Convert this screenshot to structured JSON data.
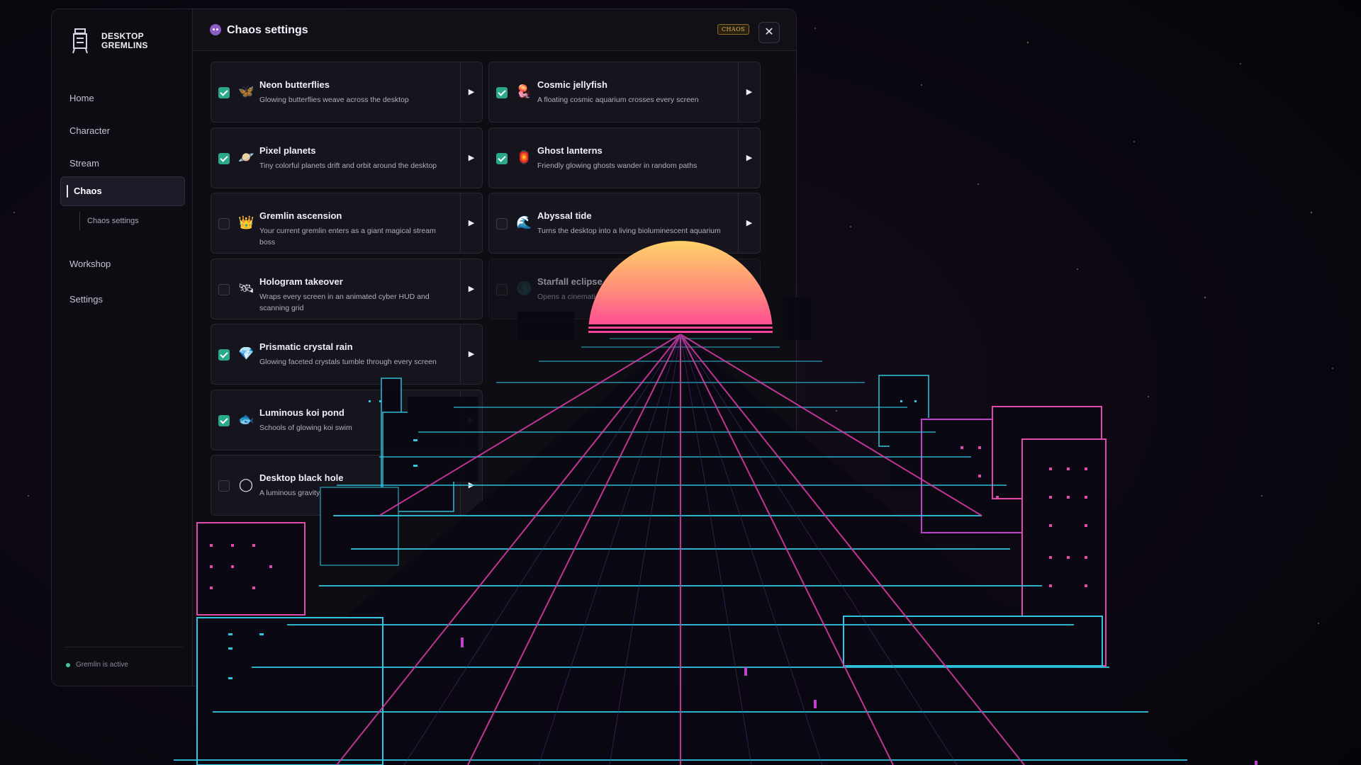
{
  "brand": {
    "name_line1": "DESKTOP",
    "name_line2": "GREMLINS"
  },
  "nav": {
    "home": "Home",
    "character": "Character",
    "stream": "Stream",
    "chaos": "Chaos",
    "chaos_settings": "Chaos settings",
    "workshop": "Workshop",
    "settings": "Settings"
  },
  "status": "Gremlin is active",
  "header": {
    "title": "Chaos settings",
    "badge": "CHAOS",
    "close": "✕"
  },
  "cards": [
    {
      "name": "Neon butterflies",
      "desc": "Glowing butterflies weave across the desktop",
      "checked": true,
      "icon": "butterfly-icon",
      "glyph": "🦋"
    },
    {
      "name": "Cosmic jellyfish",
      "desc": "A floating cosmic aquarium crosses every screen",
      "checked": true,
      "icon": "jellyfish-icon",
      "glyph": "🪼"
    },
    {
      "name": "Pixel planets",
      "desc": "Tiny colorful planets drift and orbit around the desktop",
      "checked": true,
      "icon": "planet-icon",
      "glyph": "🪐"
    },
    {
      "name": "Ghost lanterns",
      "desc": "Friendly glowing ghosts wander in random paths",
      "checked": true,
      "icon": "lantern-icon",
      "glyph": "🏮"
    },
    {
      "name": "Gremlin ascension",
      "desc": "Your current gremlin enters as a giant magical stream boss",
      "checked": false,
      "icon": "crown-icon",
      "glyph": "👑"
    },
    {
      "name": "Abyssal tide",
      "desc": "Turns the desktop into a living bioluminescent aquarium",
      "checked": false,
      "icon": "wave-icon",
      "glyph": "🌊"
    },
    {
      "name": "Hologram takeover",
      "desc": "Wraps every screen in an animated cyber HUD and scanning grid",
      "checked": false,
      "icon": "satellite-icon",
      "glyph": "🛰"
    },
    {
      "name": "Starfall eclipse",
      "desc": "Opens a cinematic desktop",
      "checked": false,
      "icon": "eclipse-icon",
      "glyph": "🌑"
    },
    {
      "name": "Prismatic crystal rain",
      "desc": "Glowing faceted crystals tumble through every screen",
      "checked": true,
      "icon": "crystal-icon",
      "glyph": "💎"
    },
    {
      "name": "Luminous koi pond",
      "desc": "Schools of glowing koi swim",
      "checked": true,
      "icon": "fish-icon",
      "glyph": "🐟"
    },
    {
      "name": "Desktop black hole",
      "desc": "A luminous gravity well its orbit",
      "checked": false,
      "icon": "black-hole-icon",
      "glyph": "◯"
    }
  ],
  "colors": {
    "accent": "#2aa887",
    "grid_magenta": "#d63aa4",
    "grid_cyan": "#2fc6e0",
    "sun_top": "#ffd36a",
    "sun_bottom": "#ff3e9a"
  }
}
